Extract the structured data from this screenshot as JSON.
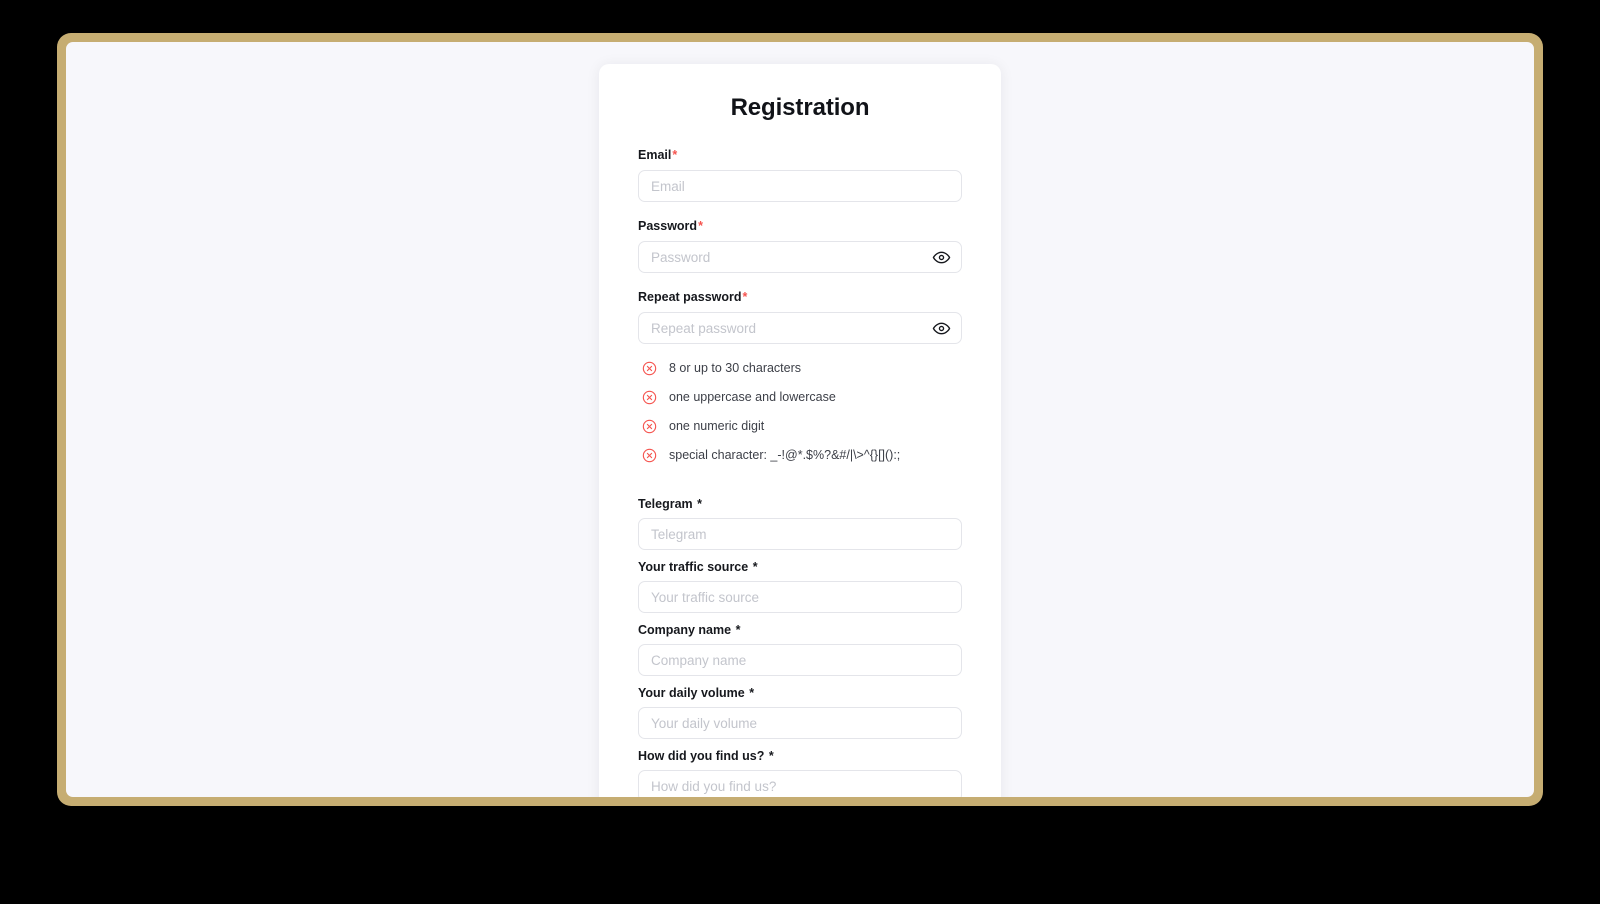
{
  "theme": {
    "frame_color": "#c6ad72",
    "page_background": "#f7f7fb",
    "card_background": "#ffffff",
    "required_asterisk_color": "#f5544f",
    "error_icon_color": "#f5544f",
    "text_color": "#16181d",
    "placeholder_color": "#c3c5cc",
    "input_border_color": "#e4e5ea"
  },
  "page": {
    "title": "Registration"
  },
  "form": {
    "fields": [
      {
        "id": "email",
        "label": "Email",
        "required_mark": "*",
        "required_mark_style": "red",
        "placeholder": "Email",
        "value": "",
        "type": "email",
        "has_toggle": false
      },
      {
        "id": "password",
        "label": "Password",
        "required_mark": "*",
        "required_mark_style": "red",
        "placeholder": "Password",
        "value": "",
        "type": "password",
        "has_toggle": true,
        "toggle_icon": "eye-icon"
      },
      {
        "id": "repeat-password",
        "label": "Repeat password",
        "required_mark": "*",
        "required_mark_style": "red",
        "placeholder": "Repeat password",
        "value": "",
        "type": "password",
        "has_toggle": true,
        "toggle_icon": "eye-icon"
      }
    ],
    "secondary_fields": [
      {
        "id": "telegram",
        "label": "Telegram",
        "required_mark": "*",
        "required_mark_style": "dark",
        "placeholder": "Telegram",
        "value": ""
      },
      {
        "id": "traffic-source",
        "label": "Your traffic source",
        "required_mark": "*",
        "required_mark_style": "dark",
        "placeholder": "Your traffic source",
        "value": ""
      },
      {
        "id": "company-name",
        "label": "Company name",
        "required_mark": "*",
        "required_mark_style": "dark",
        "placeholder": "Company name",
        "value": ""
      },
      {
        "id": "daily-volume",
        "label": "Your daily volume",
        "required_mark": "*",
        "required_mark_style": "dark",
        "placeholder": "Your daily volume",
        "value": ""
      },
      {
        "id": "how-did-you-find-us",
        "label": "How did you find us?",
        "required_mark": "*",
        "required_mark_style": "dark",
        "placeholder": "How did you find us?",
        "value": ""
      }
    ],
    "password_rules": [
      {
        "text": "8 or up to 30 characters",
        "state": "unmet",
        "icon": "error-circle-x-icon"
      },
      {
        "text": "one uppercase and lowercase",
        "state": "unmet",
        "icon": "error-circle-x-icon"
      },
      {
        "text": "one numeric digit",
        "state": "unmet",
        "icon": "error-circle-x-icon"
      },
      {
        "text": "special character: _-!@*.$%?&#/|\\>^{}[]():;",
        "state": "unmet",
        "icon": "error-circle-x-icon"
      }
    ]
  }
}
